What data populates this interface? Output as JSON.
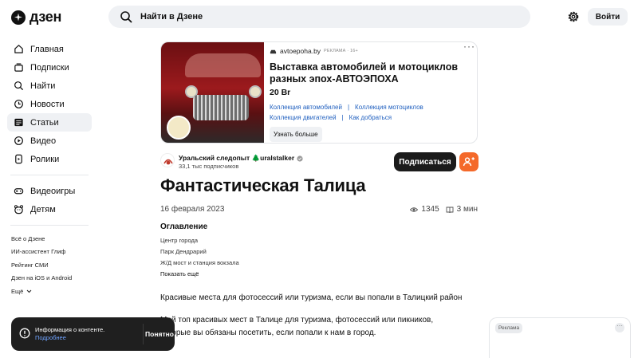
{
  "header": {
    "logo_text": "дзен",
    "search_placeholder": "Найти в Дзене",
    "login_label": "Войти"
  },
  "sidebar": {
    "items": [
      {
        "label": "Главная",
        "icon": "home-icon"
      },
      {
        "label": "Подписки",
        "icon": "subscriptions-icon"
      },
      {
        "label": "Найти",
        "icon": "search-icon"
      },
      {
        "label": "Новости",
        "icon": "clock-icon"
      },
      {
        "label": "Статьи",
        "icon": "articles-icon",
        "active": true
      },
      {
        "label": "Видео",
        "icon": "play-icon"
      },
      {
        "label": "Ролики",
        "icon": "shorts-icon"
      }
    ],
    "items2": [
      {
        "label": "Видеоигры",
        "icon": "gamepad-icon"
      },
      {
        "label": "Детям",
        "icon": "kids-icon"
      }
    ],
    "footer": [
      "Всё о Дзене",
      "ИИ-ассистент Глиф",
      "Рейтинг СМИ",
      "Дзен на iOS и Android",
      "Ещё"
    ]
  },
  "ad": {
    "source": "avtoepoha.by",
    "label": "РЕКЛАМА · 16+",
    "title": "Выставка автомобилей и мотоциклов разных эпох-АВТОЭПОХА",
    "price": "20 Br",
    "links_row1": [
      "Коллекция автомобилей",
      "Коллекция мотоциклов"
    ],
    "links_row2": [
      "Коллекция двигателей",
      "Как добраться"
    ],
    "cta": "Узнать больше"
  },
  "author": {
    "name": "Уральский следопыт 🌲uralstalker",
    "subscribers": "33,1 тыс подписчиков",
    "subscribe_label": "Подписаться"
  },
  "article": {
    "title": "Фантастическая Талица",
    "date": "16 февраля 2023",
    "views": "1345",
    "read_time": "3 мин",
    "toc_title": "Оглавление",
    "toc": [
      "Центр города",
      "Парк Дендрарий",
      "Ж/Д мост и станция вокзала"
    ],
    "toc_more": "Показать ещё",
    "para1": "Красивые места для фотосессий или туризма, если вы попали в Талицкий район",
    "para2_line1": "Мой топ красивых мест в Талице для туризма, фотосессий или пикников,",
    "para2_line2": "которые вы обязаны посетить, если попали к нам в город."
  },
  "toast": {
    "text": "Информация о контенте.",
    "link": "Подробнее",
    "button": "Понятно"
  },
  "side_ad": {
    "label": "Реклама"
  },
  "colors": {
    "accent_orange": "#f4692a",
    "link_blue": "#1f5fbf",
    "subscribe_bg": "#1b1b1b"
  }
}
